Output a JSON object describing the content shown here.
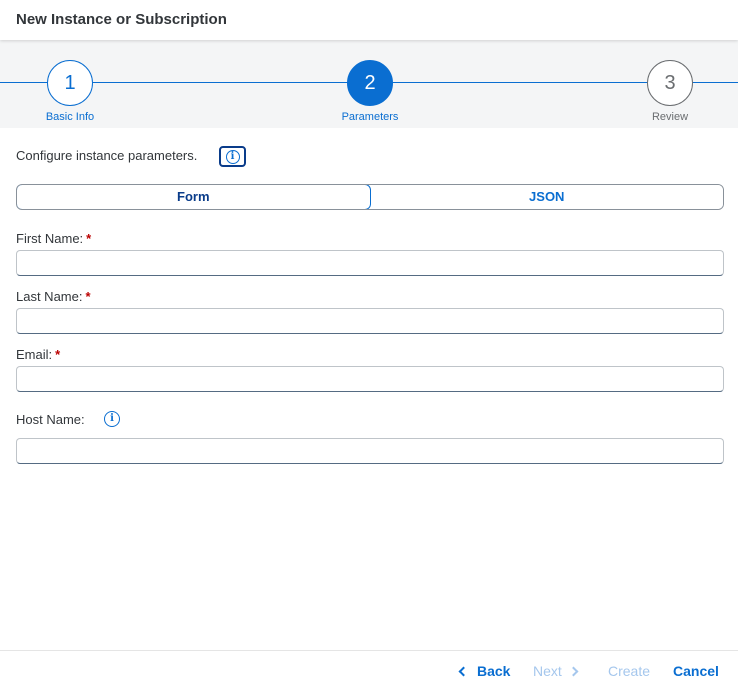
{
  "dialog": {
    "title": "New Instance or Subscription"
  },
  "wizard": {
    "steps": [
      {
        "number": "1",
        "label": "Basic Info"
      },
      {
        "number": "2",
        "label": "Parameters"
      },
      {
        "number": "3",
        "label": "Review"
      }
    ],
    "current_step": 2
  },
  "content": {
    "intro": "Configure instance parameters.",
    "tabs": [
      {
        "label": "Form",
        "selected": true
      },
      {
        "label": "JSON",
        "selected": false
      }
    ],
    "fields": [
      {
        "label": "First Name:",
        "required": "*",
        "value": ""
      },
      {
        "label": "Last Name:",
        "required": "*",
        "value": ""
      },
      {
        "label": "Email:",
        "required": "*",
        "value": ""
      },
      {
        "label": "Host Name:",
        "value": ""
      }
    ]
  },
  "footer": {
    "back": "Back",
    "next": "Next",
    "create": "Create",
    "cancel": "Cancel"
  },
  "colors": {
    "accent": "#0a6ed1",
    "required": "#bb0000",
    "disabled": "#a5c7ed"
  },
  "icons": {
    "info": "info-icon",
    "back": "chevron-left-icon",
    "next": "chevron-right-icon"
  }
}
